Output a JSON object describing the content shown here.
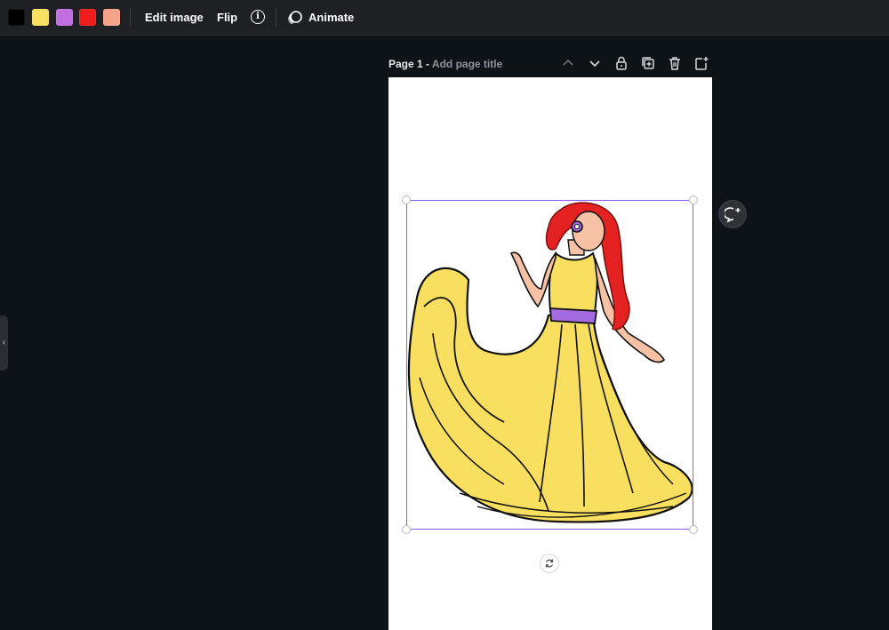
{
  "toolbar": {
    "swatches": [
      {
        "name": "black",
        "color": "#000000"
      },
      {
        "name": "yellow",
        "color": "#f8df5f"
      },
      {
        "name": "purple",
        "color": "#c16ee0"
      },
      {
        "name": "red",
        "color": "#f01d1d"
      },
      {
        "name": "peach",
        "color": "#f5a48a"
      }
    ],
    "edit_image_label": "Edit image",
    "flip_label": "Flip",
    "info_glyph": "i",
    "animate_label": "Animate"
  },
  "page": {
    "label": "Page 1 - ",
    "title_placeholder": "Add page title"
  },
  "canvas": {
    "background": "#ffffff",
    "selection_color": "#8b5cf6",
    "dress_color": "#f8df5f",
    "hair_color": "#e52222",
    "sash_color": "#a46be0",
    "skin_color": "#f7c1a6"
  }
}
